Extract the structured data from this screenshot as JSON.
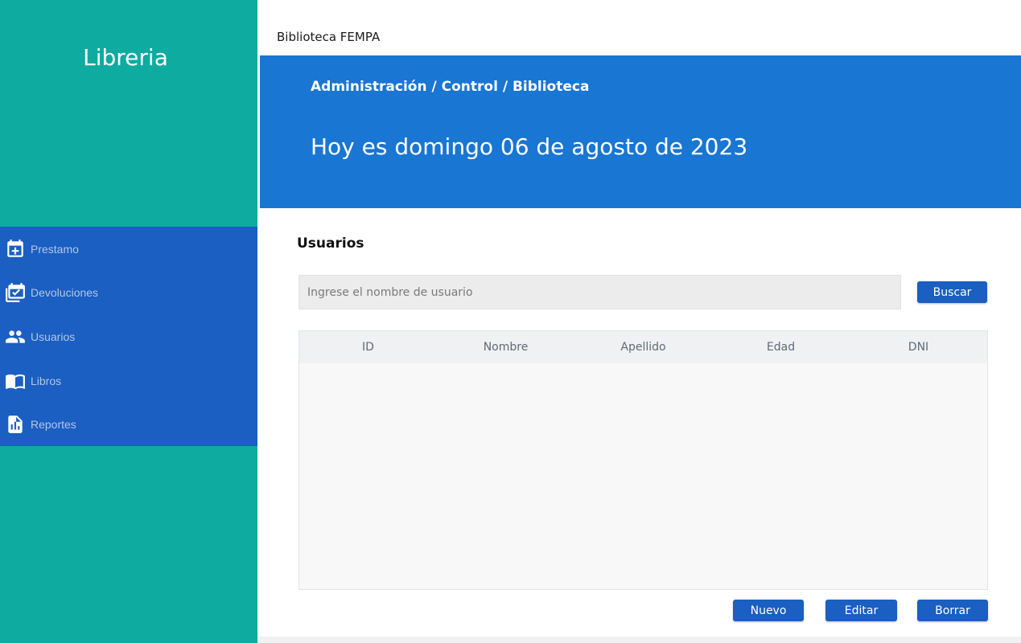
{
  "sidebar": {
    "app_title": "Libreria",
    "items": [
      {
        "label": "Prestamo",
        "icon": "calendar-plus-icon"
      },
      {
        "label": "Devoluciones",
        "icon": "calendar-check-icon"
      },
      {
        "label": "Usuarios",
        "icon": "users-icon",
        "active": true
      },
      {
        "label": "Libros",
        "icon": "book-icon"
      },
      {
        "label": "Reportes",
        "icon": "report-icon"
      }
    ]
  },
  "header": {
    "title": "Biblioteca FEMPA"
  },
  "banner": {
    "breadcrumb": "Administración / Control / Biblioteca",
    "date_text": "Hoy es domingo 06 de agosto de 2023"
  },
  "main": {
    "section_title": "Usuarios",
    "search": {
      "placeholder": "Ingrese el nombre de usuario",
      "value": "",
      "button_label": "Buscar"
    },
    "table": {
      "columns": [
        "ID",
        "Nombre",
        "Apellido",
        "Edad",
        "DNI"
      ],
      "rows": []
    },
    "actions": {
      "new_label": "Nuevo",
      "edit_label": "Editar",
      "delete_label": "Borrar"
    }
  },
  "colors": {
    "sidebar_bg": "#0eaba0",
    "nav_bg": "#1a5fc1",
    "banner_bg": "#1976d2",
    "button_bg": "#1a5fc1"
  }
}
